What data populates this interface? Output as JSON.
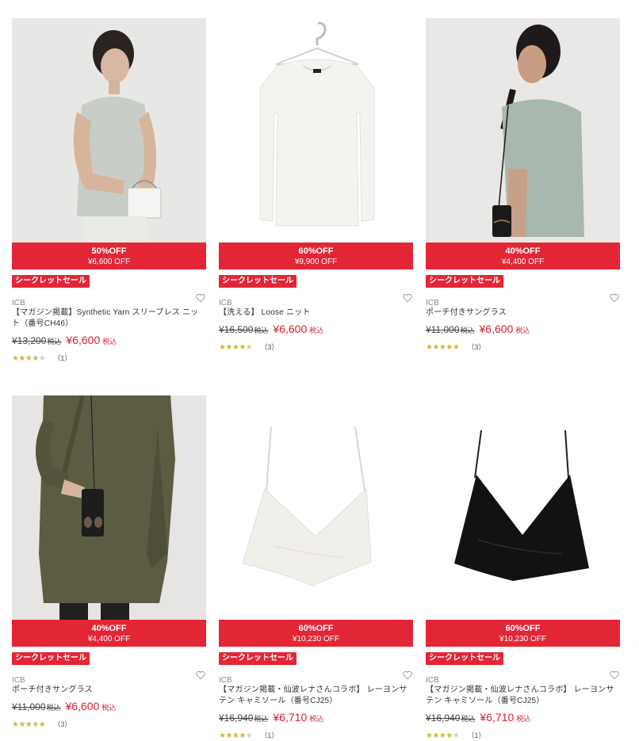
{
  "products": [
    {
      "discount": "50%OFF",
      "discount_amount": "¥6,600 OFF",
      "tag": "シークレットセール",
      "brand": "ICB",
      "name": "【マガジン掲載】Synthetic Yarn スリーブレス ニット（番号CH46）",
      "original_price": "¥13,200",
      "original_tax": "税込",
      "sale_price": "¥6,600",
      "sale_tax": "税込",
      "rating": 4,
      "rating_count": "（1）",
      "image": "woman-grey-sleeveless-top-with-bag"
    },
    {
      "discount": "60%OFF",
      "discount_amount": "¥9,900 OFF",
      "tag": "シークレットセール",
      "brand": "ICB",
      "name": "【洗える】 Loose ニット",
      "original_price": "¥16,500",
      "original_tax": "税込",
      "sale_price": "¥6,600",
      "sale_tax": "税込",
      "rating": 4.5,
      "rating_count": "（3）",
      "image": "white-knit-on-hanger"
    },
    {
      "discount": "40%OFF",
      "discount_amount": "¥4,400 OFF",
      "tag": "シークレットセール",
      "brand": "ICB",
      "name": "ポーチ付きサングラス",
      "original_price": "¥11,000",
      "original_tax": "税込",
      "sale_price": "¥6,600",
      "sale_tax": "税込",
      "rating": 5,
      "rating_count": "（3）",
      "image": "woman-with-sunglasses-pouch"
    },
    {
      "discount": "40%OFF",
      "discount_amount": "¥4,400 OFF",
      "tag": "シークレットセール",
      "brand": "ICB",
      "name": "ポーチ付きサングラス",
      "original_price": "¥11,000",
      "original_tax": "税込",
      "sale_price": "¥6,600",
      "sale_tax": "税込",
      "rating": 5,
      "rating_count": "（3）",
      "image": "olive-tunic-with-sunglasses-pouch"
    },
    {
      "discount": "60%OFF",
      "discount_amount": "¥10,230 OFF",
      "tag": "シークレットセール",
      "brand": "ICB",
      "name": "【マガジン掲載・仙波レナさんコラボ】 レーヨンサテン キャミソール（番号CJ25）",
      "original_price": "¥16,940",
      "original_tax": "税込",
      "sale_price": "¥6,710",
      "sale_tax": "税込",
      "rating": 4,
      "rating_count": "（1）",
      "image": "white-satin-camisole"
    },
    {
      "discount": "60%OFF",
      "discount_amount": "¥10,230 OFF",
      "tag": "シークレットセール",
      "brand": "ICB",
      "name": "【マガジン掲載・仙波レナさんコラボ】 レーヨンサテン キャミソール（番号CJ25）",
      "original_price": "¥16,940",
      "original_tax": "税込",
      "sale_price": "¥6,710",
      "sale_tax": "税込",
      "rating": 4,
      "rating_count": "（1）",
      "image": "black-satin-camisole"
    }
  ],
  "colors": {
    "sale_red": "#e32636",
    "price_red": "#d9202f",
    "star_gold": "#d4b33a"
  },
  "icons": {
    "favorite": "heart-outline-icon",
    "rating": "star-icon"
  }
}
